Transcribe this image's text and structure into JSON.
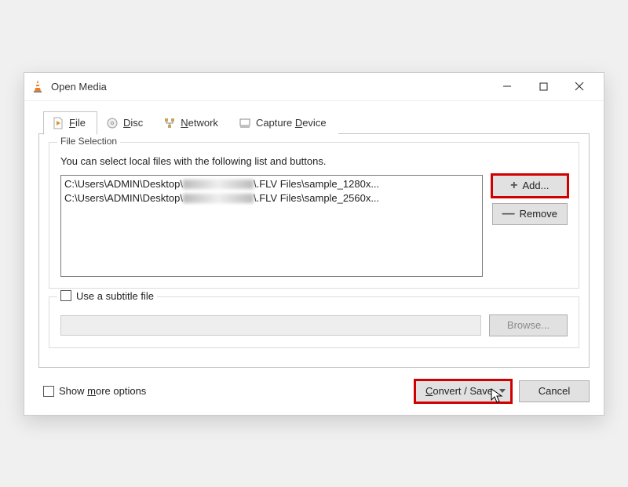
{
  "window": {
    "title": "Open Media"
  },
  "tabs": {
    "file": {
      "key": "F",
      "rest": "ile"
    },
    "disc": {
      "key": "D",
      "rest": "isc"
    },
    "network": {
      "key": "N",
      "rest": "etwork"
    },
    "capture": {
      "pre": "Capture ",
      "key": "D",
      "rest": "evice"
    }
  },
  "file_selection": {
    "legend": "File Selection",
    "desc": "You can select local files with the following list and buttons.",
    "files": [
      {
        "pre": "C:\\Users\\ADMIN\\Desktop\\",
        "post": "\\.FLV Files\\sample_1280x..."
      },
      {
        "pre": "C:\\Users\\ADMIN\\Desktop\\",
        "post": "\\.FLV Files\\sample_2560x..."
      }
    ],
    "add_label": "Add...",
    "remove_label": "Remove"
  },
  "subtitle": {
    "checkbox_label": "Use a subtitle file",
    "browse_label": "Browse..."
  },
  "more_options": {
    "pre": "Show ",
    "key": "m",
    "rest": "ore options"
  },
  "actions": {
    "convert_key": "C",
    "convert_rest": "onvert / Save",
    "cancel_label": "Cancel"
  }
}
